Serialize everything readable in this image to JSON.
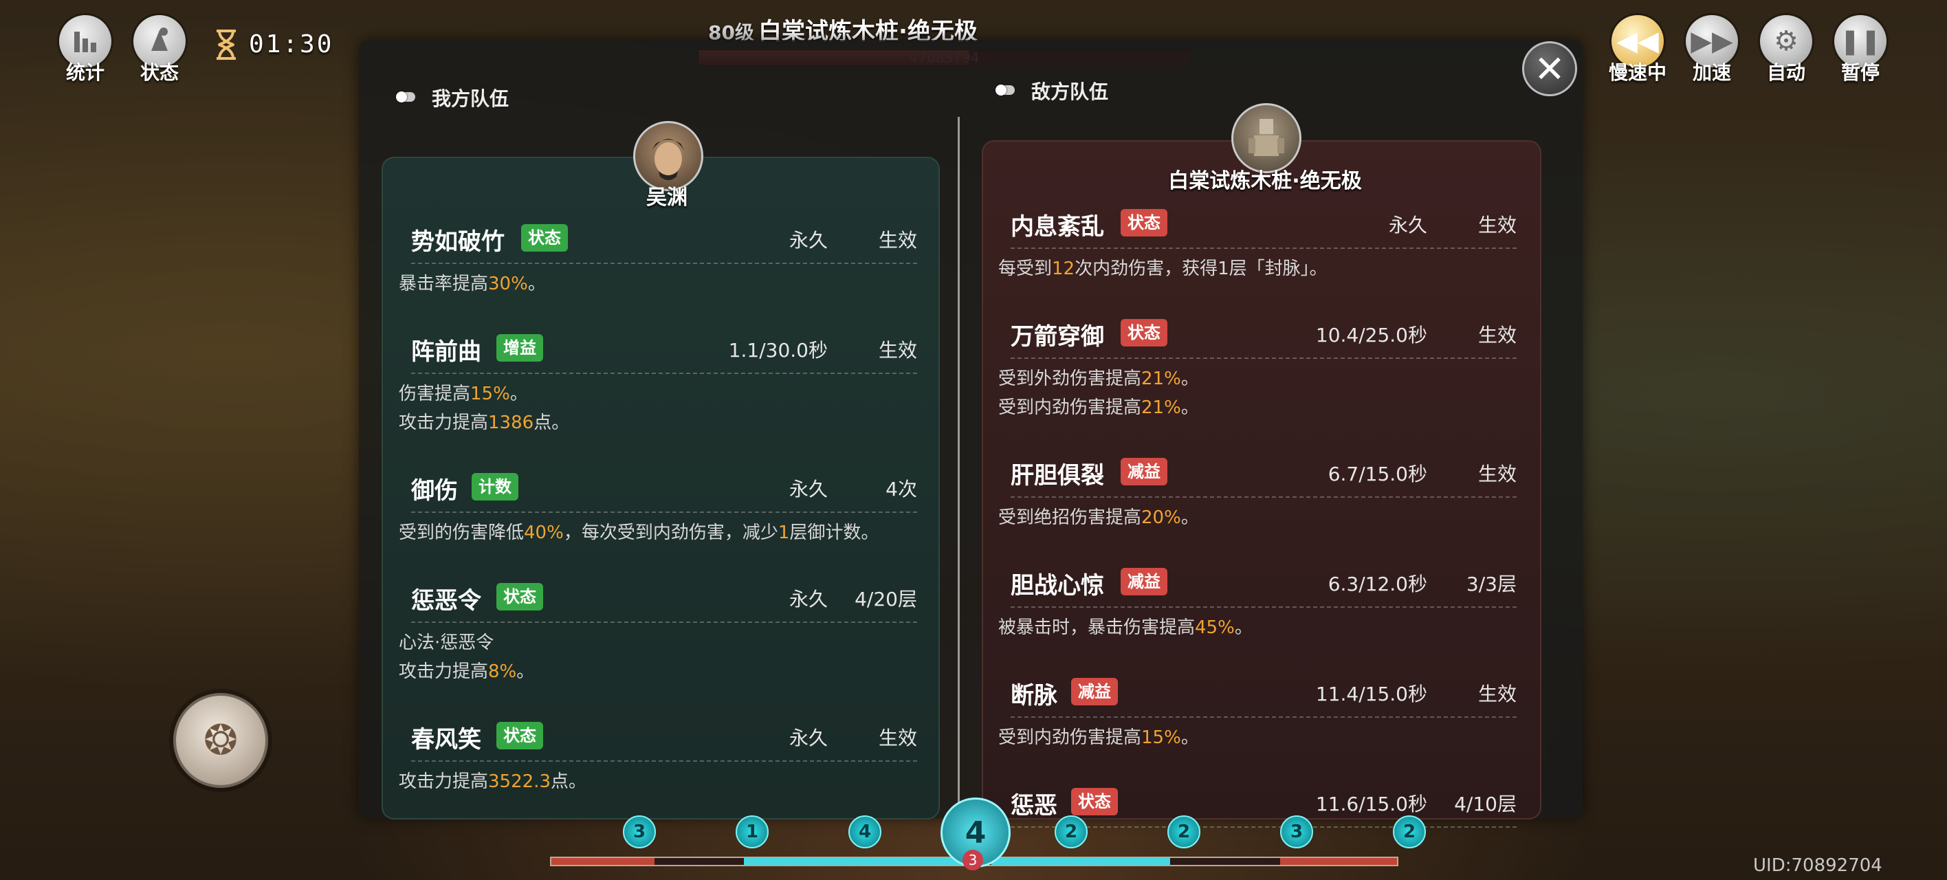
{
  "hud": {
    "stats_label": "统计",
    "status_label": "状态",
    "timer": "01:30",
    "boss_level": "80级",
    "boss_name": "白棠试炼木桩·绝无极",
    "boss_hp_text": "47083794",
    "boss_hp_fraction": 0.55,
    "uid": "UID:70892704"
  },
  "controls": {
    "slow_label": "慢速中",
    "speed_label": "加速",
    "auto_label": "自动",
    "pause_label": "暂停"
  },
  "bottom": {
    "pips": [
      "3",
      "1",
      "4",
      "2",
      "2",
      "3",
      "2"
    ],
    "center": "4",
    "center_sub": "3"
  },
  "modal": {
    "ally_title": "我方队伍",
    "enemy_title": "敌方队伍",
    "ally_name": "吴渊",
    "enemy_name": "白棠试炼木桩·绝无极",
    "ally_buffs": [
      {
        "name": "势如破竹",
        "tag": "状态",
        "tag_color": "#35a845",
        "duration": "永久",
        "state": "生效",
        "lines": [
          [
            "暴击率提高",
            "30%",
            "。"
          ]
        ]
      },
      {
        "name": "阵前曲",
        "tag": "增益",
        "tag_color": "#35a845",
        "duration": "1.1/30.0秒",
        "state": "生效",
        "lines": [
          [
            "伤害提高",
            "15%",
            "。"
          ],
          [
            "攻击力提高",
            "1386",
            "点。"
          ]
        ]
      },
      {
        "name": "御伤",
        "tag": "计数",
        "tag_color": "#35a845",
        "duration": "永久",
        "state": "4次",
        "lines": [
          [
            "受到的伤害降低",
            "40%",
            "，每次受到内劲伤害，减少",
            "1",
            "层御计数。"
          ]
        ]
      },
      {
        "name": "惩恶令",
        "tag": "状态",
        "tag_color": "#35a845",
        "duration": "永久",
        "state": "4/20层",
        "lines": [
          [
            "心法·惩恶令"
          ],
          [
            "攻击力提高",
            "8%",
            "。"
          ]
        ]
      },
      {
        "name": "春风笑",
        "tag": "状态",
        "tag_color": "#35a845",
        "duration": "永久",
        "state": "生效",
        "lines": [
          [
            "攻击力提高",
            "3522.3",
            "点。"
          ]
        ]
      }
    ],
    "enemy_buffs": [
      {
        "name": "内息紊乱",
        "tag": "状态",
        "tag_color": "#d24a43",
        "duration": "永久",
        "state": "生效",
        "lines": [
          [
            "每受到",
            "12",
            "次内劲伤害，获得1层「封脉」。"
          ]
        ]
      },
      {
        "name": "万箭穿御",
        "tag": "状态",
        "tag_color": "#d24a43",
        "duration": "10.4/25.0秒",
        "state": "生效",
        "lines": [
          [
            "受到外劲伤害提高",
            "21%",
            "。"
          ],
          [
            "受到内劲伤害提高",
            "21%",
            "。"
          ]
        ]
      },
      {
        "name": "肝胆俱裂",
        "tag": "减益",
        "tag_color": "#d24a43",
        "duration": "6.7/15.0秒",
        "state": "生效",
        "lines": [
          [
            "受到绝招伤害提高",
            "20%",
            "。"
          ]
        ]
      },
      {
        "name": "胆战心惊",
        "tag": "减益",
        "tag_color": "#d24a43",
        "duration": "6.3/12.0秒",
        "state": "3/3层",
        "lines": [
          [
            "被暴击时，暴击伤害提高",
            "45%",
            "。"
          ]
        ]
      },
      {
        "name": "断脉",
        "tag": "减益",
        "tag_color": "#d24a43",
        "duration": "11.4/15.0秒",
        "state": "生效",
        "lines": [
          [
            "受到内劲伤害提高",
            "15%",
            "。"
          ]
        ]
      },
      {
        "name": "惩恶",
        "tag": "状态",
        "tag_color": "#d24a43",
        "duration": "11.6/15.0秒",
        "state": "4/10层",
        "lines": []
      }
    ]
  }
}
